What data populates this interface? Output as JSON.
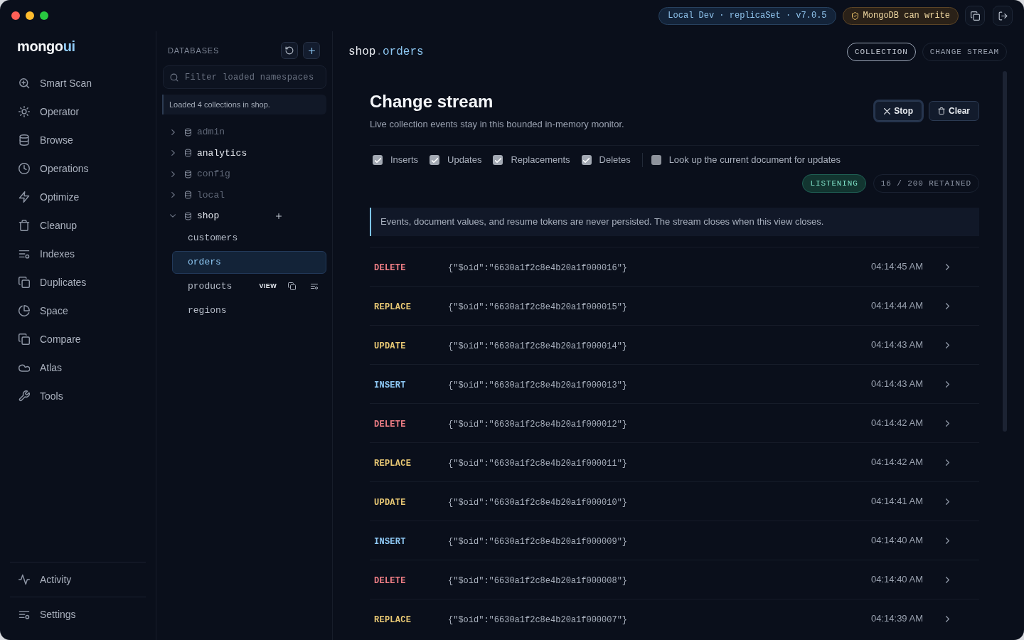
{
  "window": {
    "connection": "Local Dev · replicaSet · v7.0.5",
    "write_access": "MongoDB can write"
  },
  "sidebar": {
    "logo": {
      "primary": "mongo",
      "accent": "ui"
    },
    "items": [
      {
        "label": "Smart Scan"
      },
      {
        "label": "Operator"
      },
      {
        "label": "Browse"
      },
      {
        "label": "Operations"
      },
      {
        "label": "Optimize"
      },
      {
        "label": "Cleanup"
      },
      {
        "label": "Indexes"
      },
      {
        "label": "Duplicates"
      },
      {
        "label": "Space"
      },
      {
        "label": "Compare"
      },
      {
        "label": "Atlas"
      },
      {
        "label": "Tools"
      }
    ],
    "footer_items": [
      {
        "label": "Activity"
      },
      {
        "label": "Settings"
      }
    ]
  },
  "databases_panel": {
    "title": "DATABASES",
    "filter": {
      "placeholder": "Filter loaded namespaces"
    },
    "notice": "Loaded 4 collections in shop.",
    "databases": [
      {
        "name": "admin",
        "muted": true,
        "expanded": false
      },
      {
        "name": "analytics",
        "muted": false,
        "expanded": false
      },
      {
        "name": "config",
        "muted": true,
        "expanded": false
      },
      {
        "name": "local",
        "muted": true,
        "expanded": false
      },
      {
        "name": "shop",
        "muted": false,
        "expanded": true,
        "children": [
          {
            "name": "customers",
            "selected": false,
            "hovered": false
          },
          {
            "name": "orders",
            "selected": true,
            "hovered": false
          },
          {
            "name": "products",
            "selected": false,
            "hovered": true,
            "action_label": "VIEW"
          },
          {
            "name": "regions",
            "selected": false,
            "hovered": false
          }
        ]
      }
    ]
  },
  "main": {
    "namespace": {
      "database": "shop",
      "separator": ".",
      "collection": "orders"
    },
    "tabs": [
      {
        "label": "COLLECTION",
        "selected": true
      },
      {
        "label": "CHANGE STREAM",
        "selected": false
      }
    ],
    "title": "Change stream",
    "subtitle": "Live collection events stay in this bounded in-memory monitor.",
    "buttons": [
      {
        "label": "Stop",
        "kind": "stop",
        "focused": true
      },
      {
        "label": "Clear",
        "kind": "clear",
        "focused": false
      }
    ],
    "event_filters": [
      {
        "label": "Inserts",
        "checked": true
      },
      {
        "label": "Updates",
        "checked": true
      },
      {
        "label": "Replacements",
        "checked": true
      },
      {
        "label": "Deletes",
        "checked": true
      }
    ],
    "lookup_option": {
      "label": "Look up the current document for updates",
      "checked": false
    },
    "status": "LISTENING",
    "retained": "16 / 200 RETAINED",
    "notice": "Events, document values, and resume tokens are never persisted. The stream closes when this view closes.",
    "events": [
      {
        "type": "DELETE",
        "color": "#f07f86",
        "document_key": "{\"$oid\":\"6630a1f2c8e4b20a1f000016\"}",
        "time": "04:14:45 AM"
      },
      {
        "type": "REPLACE",
        "color": "#e8c874",
        "document_key": "{\"$oid\":\"6630a1f2c8e4b20a1f000015\"}",
        "time": "04:14:44 AM"
      },
      {
        "type": "UPDATE",
        "color": "#e8c874",
        "document_key": "{\"$oid\":\"6630a1f2c8e4b20a1f000014\"}",
        "time": "04:14:43 AM"
      },
      {
        "type": "INSERT",
        "color": "#8ec8f4",
        "document_key": "{\"$oid\":\"6630a1f2c8e4b20a1f000013\"}",
        "time": "04:14:43 AM"
      },
      {
        "type": "DELETE",
        "color": "#f07f86",
        "document_key": "{\"$oid\":\"6630a1f2c8e4b20a1f000012\"}",
        "time": "04:14:42 AM"
      },
      {
        "type": "REPLACE",
        "color": "#e8c874",
        "document_key": "{\"$oid\":\"6630a1f2c8e4b20a1f000011\"}",
        "time": "04:14:42 AM"
      },
      {
        "type": "UPDATE",
        "color": "#e8c874",
        "document_key": "{\"$oid\":\"6630a1f2c8e4b20a1f000010\"}",
        "time": "04:14:41 AM"
      },
      {
        "type": "INSERT",
        "color": "#8ec8f4",
        "document_key": "{\"$oid\":\"6630a1f2c8e4b20a1f000009\"}",
        "time": "04:14:40 AM"
      },
      {
        "type": "DELETE",
        "color": "#f07f86",
        "document_key": "{\"$oid\":\"6630a1f2c8e4b20a1f000008\"}",
        "time": "04:14:40 AM"
      },
      {
        "type": "REPLACE",
        "color": "#e8c874",
        "document_key": "{\"$oid\":\"6630a1f2c8e4b20a1f000007\"}",
        "time": "04:14:39 AM"
      }
    ]
  }
}
